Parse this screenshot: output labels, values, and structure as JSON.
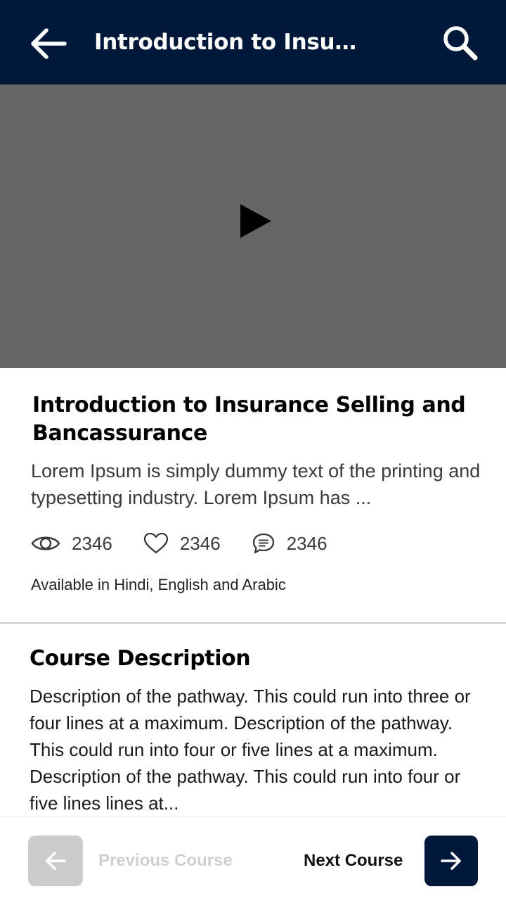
{
  "app_bar": {
    "title": "Introduction to Insur…",
    "back_icon": "arrow-left-icon",
    "search_icon": "search-icon"
  },
  "video": {
    "play_icon": "play-icon"
  },
  "course": {
    "title": "Introduction to Insurance Selling and Bancassurance",
    "summary": "Lorem Ipsum is simply dummy text of the printing and typesetting industry. Lorem Ipsum has ...",
    "stats": {
      "views": "2346",
      "likes": "2346",
      "comments": "2346"
    },
    "languages": "Available in Hindi, English and Arabic"
  },
  "description": {
    "heading": "Course Description",
    "body": "Description of the pathway. This could run into three or four lines at a maximum. Description of the pathway. This could run into four or five lines at a maximum. Description of the pathway. This could run into four or five lines lines at..."
  },
  "footer": {
    "previous_label": "Previous Course",
    "next_label": "Next Course"
  },
  "colors": {
    "primary": "#00183a",
    "video_bg": "#666666",
    "disabled": "#cccccc"
  }
}
